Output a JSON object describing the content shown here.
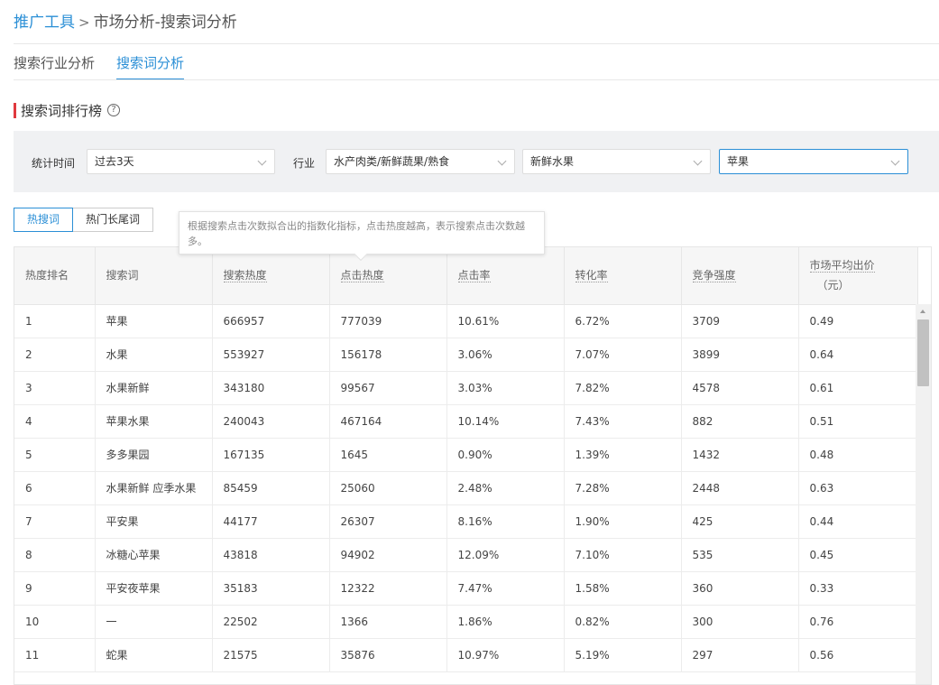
{
  "breadcrumb": {
    "root": "推广工具",
    "separator": ">",
    "current": "市场分析-搜索词分析"
  },
  "tabs": [
    {
      "label": "搜索行业分析",
      "active": false
    },
    {
      "label": "搜索词分析",
      "active": true
    }
  ],
  "section": {
    "title": "搜索词排行榜",
    "help_icon": "?"
  },
  "filters": {
    "time_label": "统计时间",
    "time_value": "过去3天",
    "industry_label": "行业",
    "industry_level1": "水产肉类/新鲜蔬果/熟食",
    "industry_level2": "新鲜水果",
    "industry_level3": "苹果"
  },
  "subtabs": [
    {
      "label": "热搜词",
      "active": true
    },
    {
      "label": "热门长尾词",
      "active": false
    }
  ],
  "tooltip": {
    "text": "根据搜索点击次数拟合出的指数化指标，点击热度越高，表示搜索点击次数越多。"
  },
  "table": {
    "headers": [
      "热度排名",
      "搜索词",
      "搜索热度",
      "点击热度",
      "点击率",
      "转化率",
      "竞争强度",
      "市场平均出价",
      "（元）"
    ],
    "rows": [
      [
        "1",
        "苹果",
        "666957",
        "777039",
        "10.61%",
        "6.72%",
        "3709",
        "0.49"
      ],
      [
        "2",
        "水果",
        "553927",
        "156178",
        "3.06%",
        "7.07%",
        "3899",
        "0.64"
      ],
      [
        "3",
        "水果新鲜",
        "343180",
        "99567",
        "3.03%",
        "7.82%",
        "4578",
        "0.61"
      ],
      [
        "4",
        "苹果水果",
        "240043",
        "467164",
        "10.14%",
        "7.43%",
        "882",
        "0.51"
      ],
      [
        "5",
        "多多果园",
        "167135",
        "1645",
        "0.90%",
        "1.39%",
        "1432",
        "0.48"
      ],
      [
        "6",
        "水果新鲜 应季水果",
        "85459",
        "25060",
        "2.48%",
        "7.28%",
        "2448",
        "0.63"
      ],
      [
        "7",
        "平安果",
        "44177",
        "26307",
        "8.16%",
        "1.90%",
        "425",
        "0.44"
      ],
      [
        "8",
        "冰糖心苹果",
        "43818",
        "94902",
        "12.09%",
        "7.10%",
        "535",
        "0.45"
      ],
      [
        "9",
        "平安夜苹果",
        "35183",
        "12322",
        "7.47%",
        "1.58%",
        "360",
        "0.33"
      ],
      [
        "10",
        "一",
        "22502",
        "1366",
        "1.86%",
        "0.82%",
        "300",
        "0.76"
      ],
      [
        "11",
        "蛇果",
        "21575",
        "35876",
        "10.97%",
        "5.19%",
        "297",
        "0.56"
      ]
    ]
  },
  "colors": {
    "accent": "#2b8fd6",
    "marker": "#e0393e",
    "filter_bg": "#f0f1f3"
  }
}
